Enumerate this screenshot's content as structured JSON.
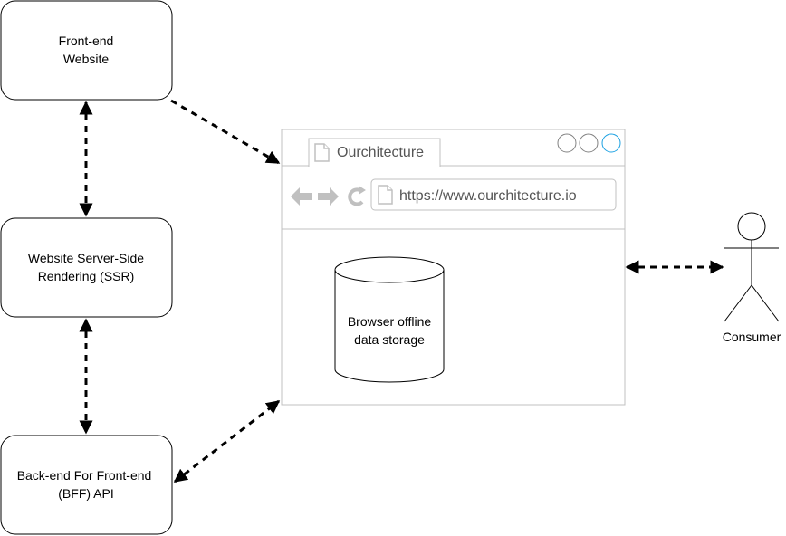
{
  "nodes": {
    "frontend_website": {
      "lines": [
        "Front-end",
        "Website"
      ]
    },
    "ssr": {
      "lines": [
        "Website Server-Side",
        "Rendering (SSR)"
      ]
    },
    "bff": {
      "lines": [
        "Back-end For Front-end",
        "(BFF) API"
      ]
    }
  },
  "browser": {
    "tab_label": "Ourchitecture",
    "url": "https://www.ourchitecture.io",
    "storage": {
      "lines": [
        "Browser offline",
        "data storage"
      ]
    }
  },
  "actor": {
    "label": "Consumer"
  },
  "colors": {
    "stroke": "#000000",
    "browser_frame": "#c0c0c0",
    "browser_icon": "#c0c0c0",
    "window_button_accent": "#1ba1e2"
  }
}
